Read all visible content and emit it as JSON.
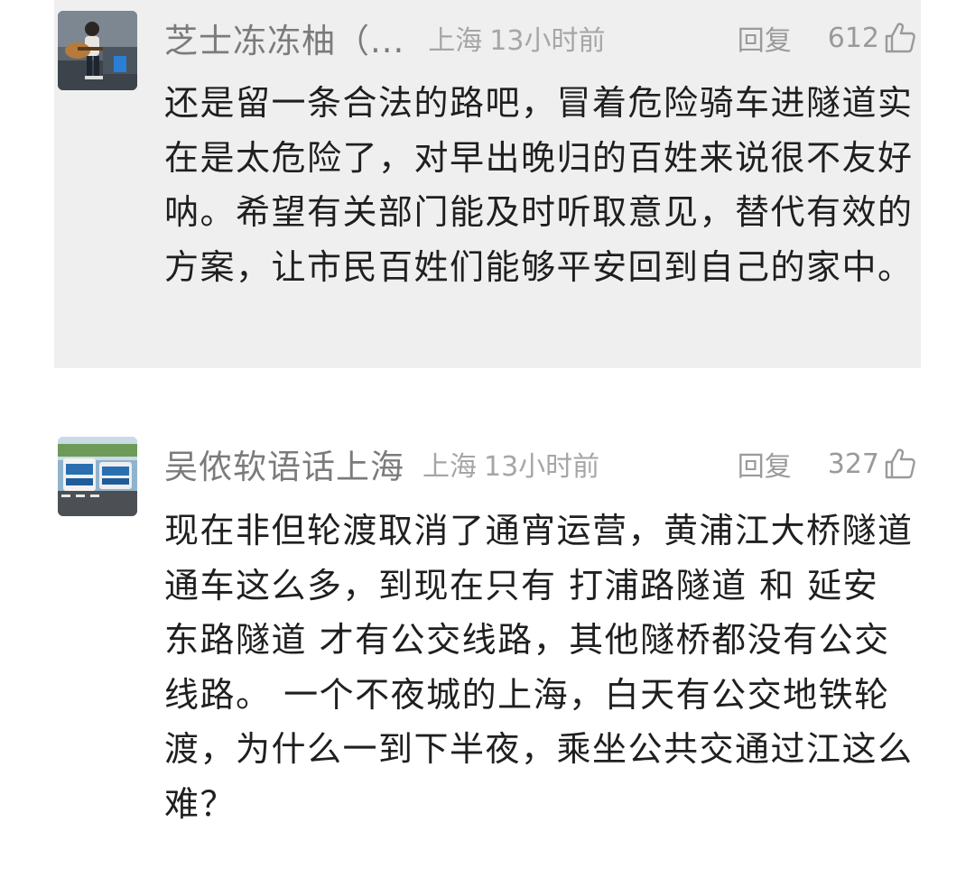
{
  "comments": [
    {
      "username": "芝士冻冻柚（...",
      "location": "上海",
      "time": "13小时前",
      "reply_label": "回复",
      "likes": "612",
      "text": "还是留一条合法的路吧，冒着危险骑车进隧道实在是太危险了，对早出晚归的百姓来说很不友好呐。希望有关部门能及时听取意见，替代有效的方案，让市民百姓们能够平安回到自己的家中。",
      "avatar_icon": "guitar-player-avatar",
      "highlighted": true
    },
    {
      "username": "吴侬软语话上海",
      "location": "上海",
      "time": "13小时前",
      "reply_label": "回复",
      "likes": "327",
      "text": "现在非但轮渡取消了通宵运营，黄浦江大桥隧道通车这么多，到现在只有 打浦路隧道 和 延安东路隧道 才有公交线路，其他隧桥都没有公交线路。 一个不夜城的上海，白天有公交地铁轮渡，为什么一到下半夜，乘坐公共交通过江这么难？",
      "avatar_icon": "bus-avatar",
      "highlighted": false
    }
  ],
  "icons": {
    "like": "thumbs-up-icon"
  },
  "colors": {
    "highlight_bg": "#efefef",
    "meta_text": "#a6a6a6",
    "username_text": "#7b7b7b",
    "body_text": "#1f1f1f"
  }
}
